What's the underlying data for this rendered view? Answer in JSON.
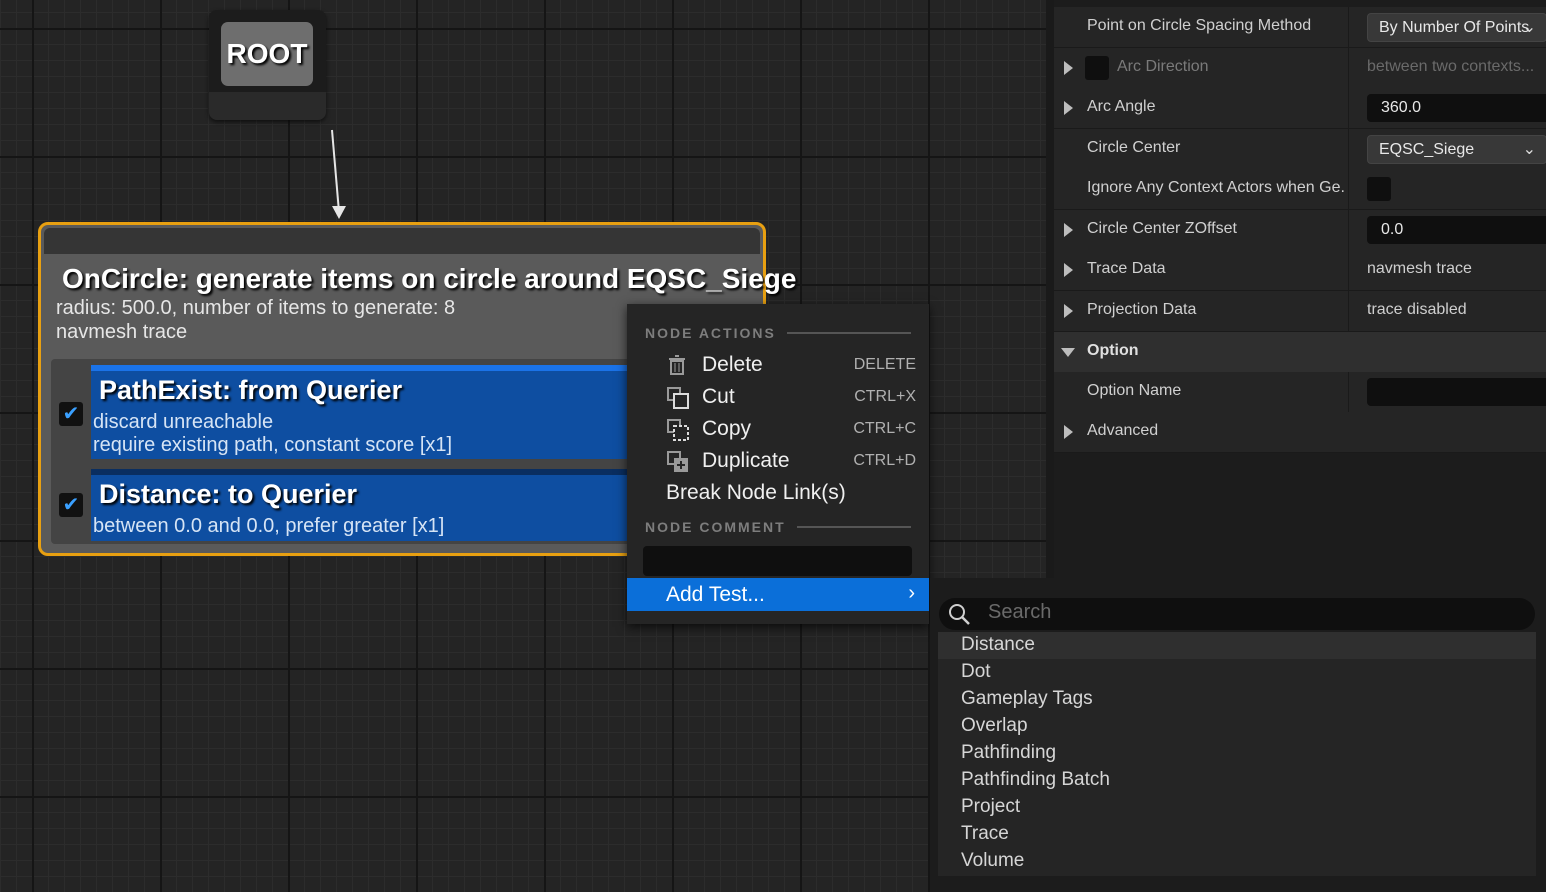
{
  "graph": {
    "root_label": "ROOT",
    "generator": {
      "title": "OnCircle: generate items on circle around EQSC_Siege",
      "line1": "radius: 500.0, number of items to generate: 8",
      "line2": "navmesh trace",
      "tests": [
        {
          "title": "PathExist: from Querier",
          "line1": "discard unreachable",
          "line2": "require existing path, constant score [x1]",
          "checked": true
        },
        {
          "title": "Distance: to Querier",
          "line1": "between 0.0 and 0.0, prefer greater [x1]",
          "checked": true
        }
      ]
    }
  },
  "details": {
    "rows": [
      {
        "label": "Point on Circle Spacing Method",
        "value": "By Number Of Points",
        "kind": "combo"
      },
      {
        "label": "Arc Direction",
        "value": "between two contexts...",
        "kind": "disabled"
      },
      {
        "label": "Arc Angle",
        "value": "360.0",
        "kind": "field"
      },
      {
        "label": "Circle Center",
        "value": "EQSC_Siege",
        "kind": "combo"
      },
      {
        "label": "Ignore Any Context Actors when Ge...",
        "value": "",
        "kind": "checkbox"
      },
      {
        "label": "Circle Center ZOffset",
        "value": "0.0",
        "kind": "field"
      },
      {
        "label": "Trace Data",
        "value": "navmesh trace",
        "kind": "text"
      },
      {
        "label": "Projection Data",
        "value": "trace disabled",
        "kind": "text"
      }
    ],
    "option_category": "Option",
    "option_name_label": "Option Name",
    "option_name_value": "",
    "advanced_label": "Advanced"
  },
  "context_menu": {
    "section_actions": "NODE ACTIONS",
    "items": [
      {
        "label": "Delete",
        "shortcut": "DELETE",
        "icon": "trash-icon"
      },
      {
        "label": "Cut",
        "shortcut": "CTRL+X",
        "icon": "cut-icon"
      },
      {
        "label": "Copy",
        "shortcut": "CTRL+C",
        "icon": "copy-icon"
      },
      {
        "label": "Duplicate",
        "shortcut": "CTRL+D",
        "icon": "duplicate-icon"
      }
    ],
    "break_links": "Break Node Link(s)",
    "section_comment": "NODE COMMENT",
    "add_test": "Add Test..."
  },
  "submenu": {
    "search_placeholder": "Search",
    "items": [
      "Distance",
      "Dot",
      "Gameplay Tags",
      "Overlap",
      "Pathfinding",
      "Pathfinding Batch",
      "Project",
      "Trace",
      "Volume"
    ]
  },
  "colors": {
    "selection_border": "#e8a011",
    "test_blue": "#0e4ea1",
    "menu_highlight": "#0b6fd9"
  }
}
